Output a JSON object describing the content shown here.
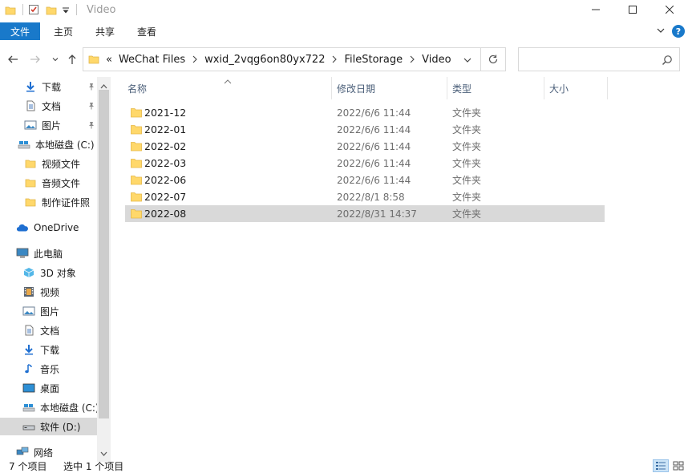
{
  "window": {
    "title": "Video"
  },
  "ribbon": {
    "tabs": [
      "文件",
      "主页",
      "共享",
      "查看"
    ],
    "help_label": "?"
  },
  "address": {
    "overflow_label": "«",
    "crumbs": [
      "WeChat Files",
      "wxid_2vqg6on80yx722",
      "FileStorage",
      "Video"
    ]
  },
  "search": {
    "placeholder": ""
  },
  "sidebar": {
    "quick_access": [
      {
        "label": "下载",
        "icon": "download-arrow-icon",
        "pinned": true
      },
      {
        "label": "文档",
        "icon": "document-icon",
        "pinned": true
      },
      {
        "label": "图片",
        "icon": "pictures-icon",
        "pinned": true
      },
      {
        "label": "本地磁盘 (C:)",
        "icon": "drive-icon",
        "pinned": false
      },
      {
        "label": "视频文件",
        "icon": "folder-icon",
        "pinned": false
      },
      {
        "label": "音频文件",
        "icon": "folder-icon",
        "pinned": false
      },
      {
        "label": "制作证件照",
        "icon": "folder-icon",
        "pinned": false
      }
    ],
    "onedrive": "OneDrive",
    "this_pc": "此电脑",
    "pc_items": [
      {
        "label": "3D 对象",
        "icon": "3d-objects-icon"
      },
      {
        "label": "视频",
        "icon": "videos-icon"
      },
      {
        "label": "图片",
        "icon": "pictures-icon"
      },
      {
        "label": "文档",
        "icon": "document-icon"
      },
      {
        "label": "下载",
        "icon": "download-arrow-icon"
      },
      {
        "label": "音乐",
        "icon": "music-note-icon"
      },
      {
        "label": "桌面",
        "icon": "desktop-icon"
      },
      {
        "label": "本地磁盘 (C:)",
        "icon": "drive-icon"
      },
      {
        "label": "软件 (D:)",
        "icon": "drive-icon",
        "selected": true
      }
    ],
    "network": "网络"
  },
  "columns": {
    "name": "名称",
    "date": "修改日期",
    "type": "类型",
    "size": "大小"
  },
  "files": [
    {
      "name": "2021-12",
      "date": "2022/6/6 11:44",
      "type": "文件夹"
    },
    {
      "name": "2022-01",
      "date": "2022/6/6 11:44",
      "type": "文件夹"
    },
    {
      "name": "2022-02",
      "date": "2022/6/6 11:44",
      "type": "文件夹"
    },
    {
      "name": "2022-03",
      "date": "2022/6/6 11:44",
      "type": "文件夹"
    },
    {
      "name": "2022-06",
      "date": "2022/6/6 11:44",
      "type": "文件夹"
    },
    {
      "name": "2022-07",
      "date": "2022/8/1 8:58",
      "type": "文件夹"
    },
    {
      "name": "2022-08",
      "date": "2022/8/31 14:37",
      "type": "文件夹",
      "selected": true
    }
  ],
  "status": {
    "item_count": "7 个项目",
    "selection": "选中 1 个项目"
  },
  "colors": {
    "accent": "#1979ca",
    "folder": "#ffd86b",
    "selection": "#d9d9d9"
  }
}
